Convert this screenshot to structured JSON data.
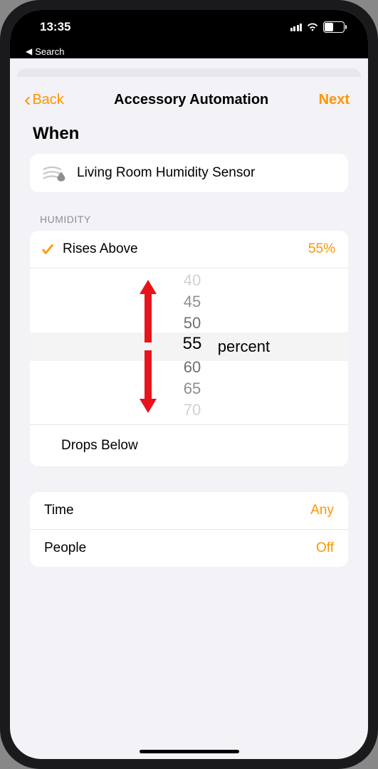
{
  "status": {
    "time": "13:35",
    "battery": "46",
    "breadcrumb": "Search"
  },
  "nav": {
    "back": "Back",
    "title": "Accessory Automation",
    "next": "Next"
  },
  "page": {
    "section": "When",
    "sensor_name": "Living Room Humidity Sensor"
  },
  "humidity": {
    "header": "HUMIDITY",
    "rises_label": "Rises Above",
    "rises_value": "55%",
    "drops_label": "Drops Below",
    "unit": "percent",
    "picker": {
      "v40": "40",
      "v45": "45",
      "v50": "50",
      "v55": "55",
      "v60": "60",
      "v65": "65",
      "v70": "70"
    }
  },
  "settings": {
    "time_label": "Time",
    "time_value": "Any",
    "people_label": "People",
    "people_value": "Off"
  }
}
